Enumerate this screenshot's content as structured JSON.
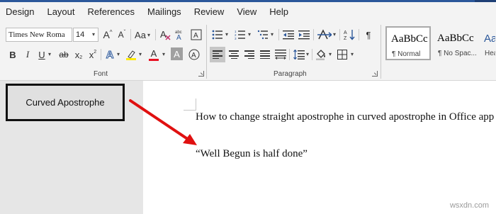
{
  "tabs": [
    "Design",
    "Layout",
    "References",
    "Mailings",
    "Review",
    "View",
    "Help"
  ],
  "ribbon": {
    "font": {
      "name": "Times New Roma",
      "size": "14",
      "grow": "A",
      "shrink": "A",
      "case": "Aa",
      "clear": "A",
      "bold": "B",
      "italic": "I",
      "underline": "U",
      "strike": "ab",
      "subscript": "x",
      "superscript": "x",
      "text_effects": "A",
      "font_color": "A",
      "char_shading": "A",
      "label": "Font",
      "highlight_color": "#ffeb00",
      "font_color_value": "#e81123"
    },
    "paragraph": {
      "label": "Paragraph",
      "pilcrow": "¶"
    },
    "styles": [
      {
        "sample": "AaBbCc",
        "name": "¶ Normal"
      },
      {
        "sample": "AaBbCc",
        "name": "¶ No Spac..."
      },
      {
        "sample": "AaBbC",
        "name": "Hea"
      }
    ]
  },
  "callout": {
    "text": "Curved Apostrophe"
  },
  "document": {
    "line1": "How to change straight apostrophe in curved apostrophe in Office app",
    "line2": "“Well Begun is half done”"
  },
  "watermark": "wsxdn.com",
  "colors": {
    "accent": "#2b579a",
    "arrow": "#e01010"
  }
}
